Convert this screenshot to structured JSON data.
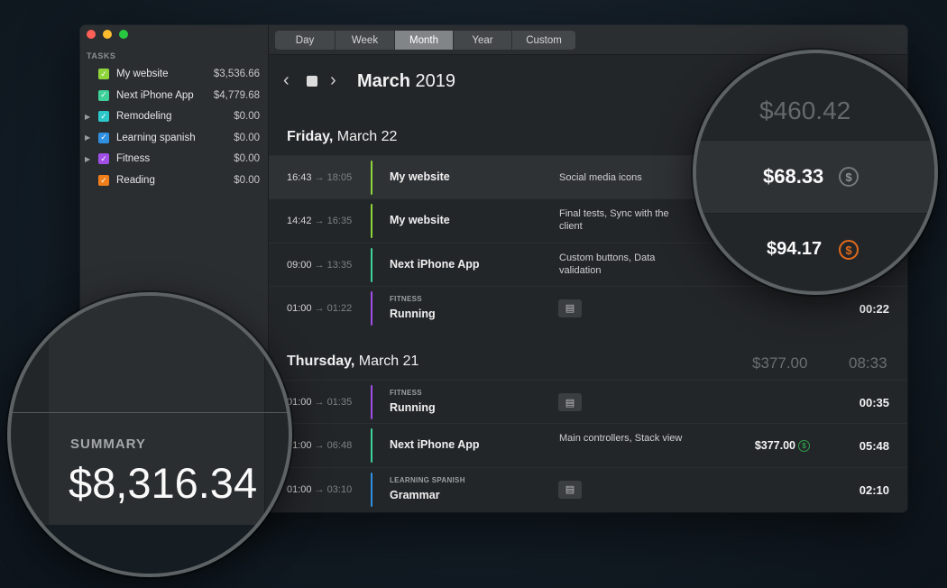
{
  "window_controls": [
    "close",
    "minimize",
    "zoom"
  ],
  "sidebar": {
    "heading": "TASKS",
    "tasks": [
      {
        "name": "My website",
        "amount": "$3,536.66",
        "color": "#8ed43b",
        "expandable": false
      },
      {
        "name": "Next iPhone App",
        "amount": "$4,779.68",
        "color": "#3fd19a",
        "expandable": false
      },
      {
        "name": "Remodeling",
        "amount": "$0.00",
        "color": "#2cc7c9",
        "expandable": true
      },
      {
        "name": "Learning spanish",
        "amount": "$0.00",
        "color": "#2f8fe0",
        "expandable": true
      },
      {
        "name": "Fitness",
        "amount": "$0.00",
        "color": "#a04ee6",
        "expandable": true
      },
      {
        "name": "Reading",
        "amount": "$0.00",
        "color": "#f07f1b",
        "expandable": false
      }
    ]
  },
  "toolbar": {
    "segments": [
      "Day",
      "Week",
      "Month",
      "Year",
      "Custom"
    ],
    "active": "Month"
  },
  "nav": {
    "prev": "‹",
    "next": "›",
    "month": "March",
    "year": "2019"
  },
  "days": [
    {
      "weekday": "Friday,",
      "date": "March 22",
      "entries": [
        {
          "start": "16:43",
          "end": "18:05",
          "tag": "",
          "title": "My website",
          "note": "Social media icons",
          "color": "#8ed43b",
          "duration": ""
        },
        {
          "start": "14:42",
          "end": "16:35",
          "tag": "",
          "title": "My website",
          "note": "Final tests, Sync with the client",
          "color": "#8ed43b",
          "duration": ""
        },
        {
          "start": "09:00",
          "end": "13:35",
          "tag": "",
          "title": "Next iPhone App",
          "note": "Custom buttons, Data validation",
          "color": "#3fd19a",
          "duration": ""
        },
        {
          "start": "01:00",
          "end": "01:22",
          "tag": "FITNESS",
          "title": "Running",
          "note": "",
          "color": "#a04ee6",
          "duration": "00:22"
        }
      ]
    },
    {
      "weekday": "Thursday,",
      "date": "March 21",
      "total_money": "$377.00",
      "total_time": "08:33",
      "entries": [
        {
          "start": "01:00",
          "end": "01:35",
          "tag": "FITNESS",
          "title": "Running",
          "note": "",
          "color": "#a04ee6",
          "duration": "00:35"
        },
        {
          "start": "01:00",
          "end": "06:48",
          "tag": "",
          "title": "Next iPhone App",
          "note": "Main controllers, Stack view",
          "color": "#3fd19a",
          "duration": "05:48",
          "money": "$377.00"
        },
        {
          "start": "01:00",
          "end": "03:10",
          "tag": "LEARNING SPANISH",
          "title": "Grammar",
          "note": "",
          "color": "#2f8fe0",
          "duration": "02:10"
        }
      ]
    }
  ],
  "zoom_right": {
    "month_total": "$460.42",
    "entry_amount_1": "$68.33",
    "entry_amount_2": "$94.17",
    "coin_symbol": "$"
  },
  "zoom_left": {
    "summary_label": "SUMMARY",
    "summary_value": "$8,316.34"
  },
  "colors": {
    "paid": "#2e9e4b",
    "unpaid": "#e06a1d"
  }
}
